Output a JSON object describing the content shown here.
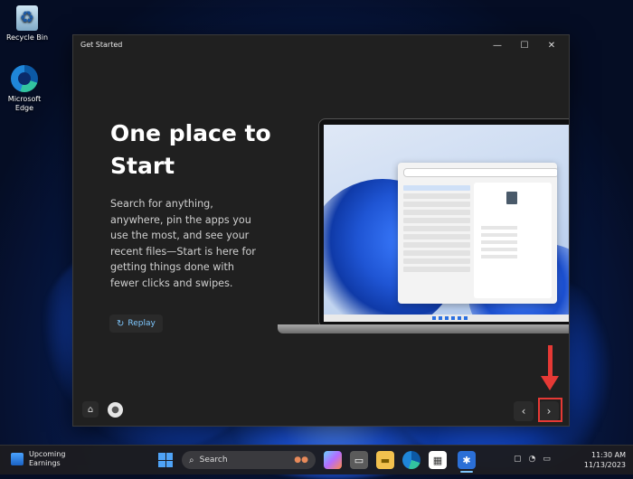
{
  "desktop": {
    "icons": [
      {
        "label": "Recycle Bin",
        "icon": "recycle-bin-icon"
      },
      {
        "label": "Microsoft Edge",
        "icon": "edge-icon"
      }
    ]
  },
  "window": {
    "title": "Get Started",
    "controls": {
      "minimize": "—",
      "maximize": "☐",
      "close": "✕"
    },
    "headline": "One place to Start",
    "body": "Search for anything, anywhere, pin the apps you use the most, and see your recent files—Start is here for getting things done with fewer clicks and swipes.",
    "replay_label": "Replay",
    "replay_glyph": "↻",
    "home_glyph": "⌂",
    "prev_glyph": "‹",
    "next_glyph": "›"
  },
  "taskbar": {
    "weather_line1": "Upcoming",
    "weather_line2": "Earnings",
    "search_label": "Search",
    "time": "11:30 AM",
    "date": "11/13/2023"
  },
  "colors": {
    "accent": "#7fc8ff",
    "annotation": "#e53935"
  }
}
